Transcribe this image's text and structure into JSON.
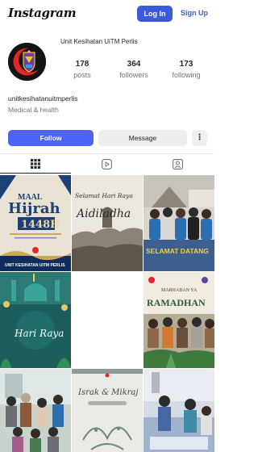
{
  "header": {
    "logo": "Instagram",
    "login_label": "Log In",
    "signup_label": "Sign Up"
  },
  "profile": {
    "display_name": "Unit Kesihatan UiTM Perlis",
    "username": "unitkesihatanuitmperlis",
    "category": "Medical & health",
    "stats": [
      {
        "value": "178",
        "label": "posts"
      },
      {
        "value": "364",
        "label": "followers"
      },
      {
        "value": "173",
        "label": "following"
      }
    ],
    "follow_label": "Follow",
    "message_label": "Message",
    "more_label": "⋮"
  },
  "tabs": [
    {
      "icon": "grid-icon",
      "active": true
    },
    {
      "icon": "reels-icon",
      "active": false
    },
    {
      "icon": "tagged-icon",
      "active": false
    }
  ],
  "posts": [
    {
      "kind": "maal-hijrah",
      "texts": [
        "MAAL",
        "Hijrah",
        "1448H",
        "UNIT KESIHATAN UiTM PERLIS"
      ]
    },
    {
      "kind": "aidiladha",
      "texts": [
        "Selamat Hari Raya",
        "Aidiladha"
      ]
    },
    {
      "kind": "selamat-datang",
      "texts": [
        "SELAMAT DATANG"
      ]
    },
    {
      "kind": "hari-raya",
      "texts": [
        "Hari Raya"
      ]
    },
    {
      "kind": "blank",
      "texts": []
    },
    {
      "kind": "ramadhan",
      "texts": [
        "MARHABAN YA",
        "RAMADHAN"
      ]
    },
    {
      "kind": "group-photo",
      "texts": []
    },
    {
      "kind": "isra-mikraj",
      "texts": [
        "Israk & Mikraj"
      ]
    },
    {
      "kind": "event-photo",
      "texts": []
    }
  ],
  "colors": {
    "accent": "#3b5bdb",
    "follow": "#4c63f5",
    "logo_ring": "#e4262b"
  }
}
